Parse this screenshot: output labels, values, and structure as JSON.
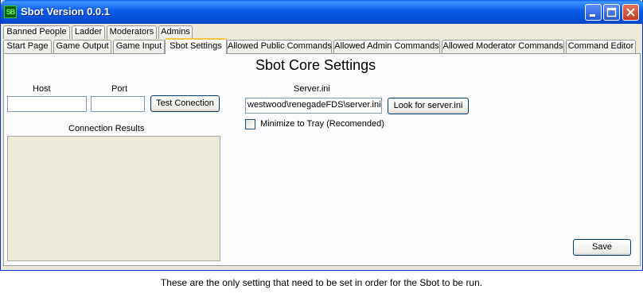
{
  "window": {
    "title": "Sbot Version 0.0.1",
    "icon_text": "SB",
    "icon": "sbot-app-icon",
    "controls": {
      "minimize": "minimize-icon",
      "maximize": "maximize-icon",
      "close": "close-icon"
    }
  },
  "tabs_row1": [
    "Banned People",
    "Ladder",
    "Moderators",
    "Admins"
  ],
  "tabs_row2": [
    "Start Page",
    "Game Output",
    "Game Input",
    "Sbot Settings",
    "Allowed Public Commands",
    "Allowed Admin Commands",
    "Allowed Moderator Commands",
    "Command Editor"
  ],
  "active_tab": "Sbot Settings",
  "settings": {
    "heading": "Sbot Core Settings",
    "host_label": "Host",
    "host_value": "",
    "port_label": "Port",
    "port_value": "",
    "test_button": "Test Conection",
    "results_label": "Connection Results",
    "server_ini_label": "Server.ini",
    "server_ini_value": "westwood\\renegadeFDS\\server.ini",
    "look_button": "Look for server.ini",
    "minimize_label": "Minimize to Tray (Recomended)",
    "minimize_checked": false,
    "save_button": "Save"
  },
  "caption": "These are the only setting that need to be set in order for the Sbot to be run."
}
